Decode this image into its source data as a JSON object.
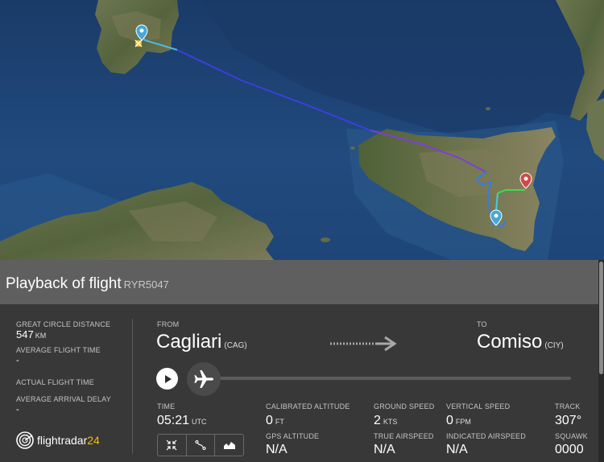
{
  "panel": {
    "title": "Playback of flight",
    "flight_number": "RYR5047"
  },
  "stats": {
    "great_circle_label": "GREAT CIRCLE DISTANCE",
    "great_circle_value": "547",
    "great_circle_unit": "KM",
    "avg_flight_time_label": "AVERAGE FLIGHT TIME",
    "avg_flight_time_value": "-",
    "actual_flight_time_label": "ACTUAL FLIGHT TIME",
    "avg_arrival_delay_label": "AVERAGE ARRIVAL DELAY",
    "avg_arrival_delay_value": "-"
  },
  "logo": {
    "name": "flightradar",
    "suffix": "24"
  },
  "route": {
    "from_label": "FROM",
    "from_city": "Cagliari",
    "from_code": "(CAG)",
    "to_label": "TO",
    "to_city": "Comiso",
    "to_code": "(CIY)"
  },
  "telemetry": {
    "time_label": "TIME",
    "time_value": "05:21",
    "time_unit": "UTC",
    "cal_alt_label": "CALIBRATED ALTITUDE",
    "cal_alt_value": "0",
    "cal_alt_unit": "FT",
    "gps_alt_label": "GPS ALTITUDE",
    "gps_alt_value": "N/A",
    "ground_speed_label": "GROUND SPEED",
    "ground_speed_value": "2",
    "ground_speed_unit": "KTS",
    "true_airspeed_label": "TRUE AIRSPEED",
    "true_airspeed_value": "N/A",
    "vertical_speed_label": "VERTICAL SPEED",
    "vertical_speed_value": "0",
    "vertical_speed_unit": "FPM",
    "indicated_airspeed_label": "INDICATED AIRSPEED",
    "indicated_airspeed_value": "N/A",
    "track_label": "TRACK",
    "track_value": "307°",
    "squawk_label": "SQUAWK",
    "squawk_value": "0000"
  },
  "colors": {
    "sea": "#1d3f6e",
    "land": "#5d6a45",
    "track_blue": "#2b3fe0",
    "track_purple": "#7a3fd8",
    "track_green": "#3ddc4a",
    "track_cyan": "#3fd0e0",
    "panel": "#383838",
    "header": "#5f5f5f",
    "brand_yellow": "#f5c000"
  },
  "icons": {
    "play": "play-icon",
    "plane": "airplane-icon",
    "arrow": "dotted-arrow-right-icon",
    "fit": "fit-view-icon",
    "route": "route-icon",
    "chart": "altitude-chart-icon",
    "origin_pin": "map-pin-origin-icon",
    "dest_pin": "map-pin-destination-icon"
  }
}
